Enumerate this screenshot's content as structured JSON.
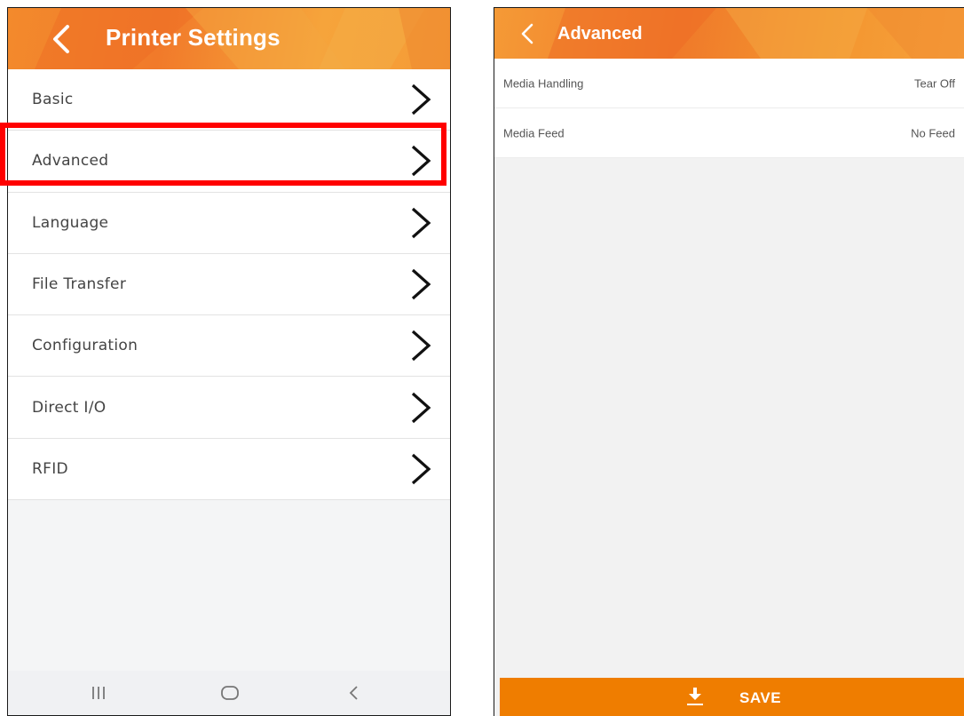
{
  "left_screen": {
    "header": {
      "title": "Printer Settings"
    },
    "menu_items": [
      {
        "label": "Basic"
      },
      {
        "label": "Advanced"
      },
      {
        "label": "Language"
      },
      {
        "label": "File Transfer"
      },
      {
        "label": "Configuration"
      },
      {
        "label": "Direct I/O"
      },
      {
        "label": "RFID"
      }
    ],
    "highlighted_item": "Advanced",
    "highlight_color": "#ff0000",
    "nav_icons": [
      "recent-apps-icon",
      "home-icon",
      "back-icon"
    ]
  },
  "right_screen": {
    "header": {
      "title": "Advanced"
    },
    "settings": [
      {
        "label": "Media Handling",
        "value": "Tear Off"
      },
      {
        "label": "Media Feed",
        "value": "No Feed"
      }
    ],
    "save_button": {
      "label": "SAVE",
      "icon": "download-icon"
    }
  },
  "colors": {
    "header_orange": "#f17a2a",
    "save_orange": "#ef7d00"
  }
}
